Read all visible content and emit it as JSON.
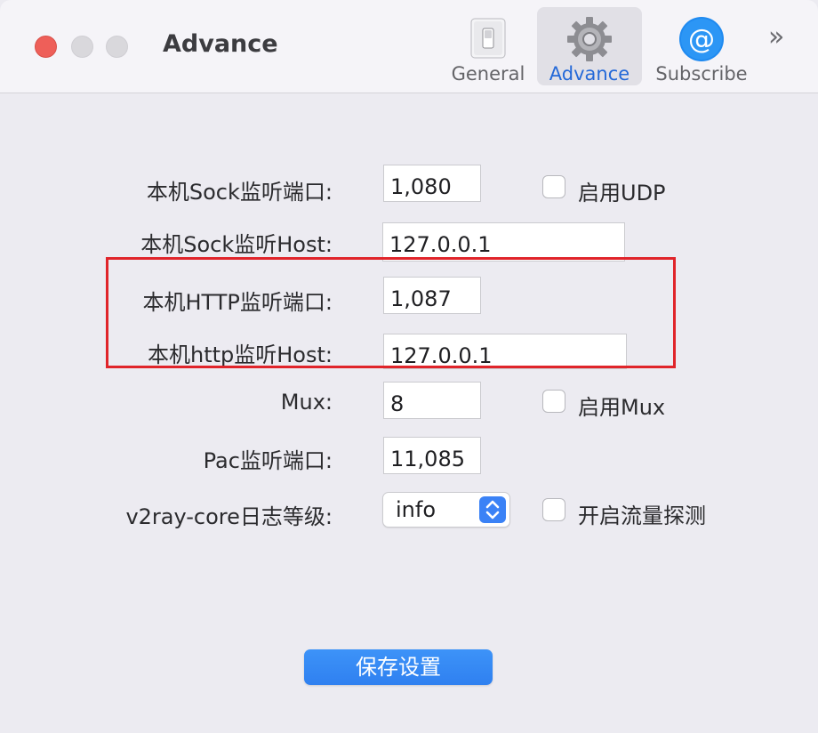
{
  "window": {
    "title": "Advance",
    "toolbar": {
      "general_label": "General",
      "advance_label": "Advance",
      "subscribe_label": "Subscribe",
      "more_label": "»"
    }
  },
  "form": {
    "socks_port": {
      "label": "本机Sock监听端口:",
      "value": "1,080"
    },
    "udp": {
      "label": "启用UDP",
      "checked": false
    },
    "socks_host": {
      "label": "本机Sock监听Host:",
      "value": "127.0.0.1"
    },
    "http_port": {
      "label": "本机HTTP监听端口:",
      "value": "1,087"
    },
    "http_host": {
      "label": "本机http监听Host:",
      "value": "127.0.0.1"
    },
    "mux": {
      "label": "Mux:",
      "value": "8"
    },
    "mux_enable": {
      "label": "启用Mux",
      "checked": false
    },
    "pac_port": {
      "label": "Pac监听端口:",
      "value": "11,085"
    },
    "log_level": {
      "label": "v2ray-core日志等级:",
      "value": "info"
    },
    "traffic_detect": {
      "label": "开启流量探测",
      "checked": false
    }
  },
  "save_button": "保存设置",
  "colors": {
    "accent": "#2f80f0",
    "highlight": "#e0242a",
    "close": "#ee5f59"
  }
}
